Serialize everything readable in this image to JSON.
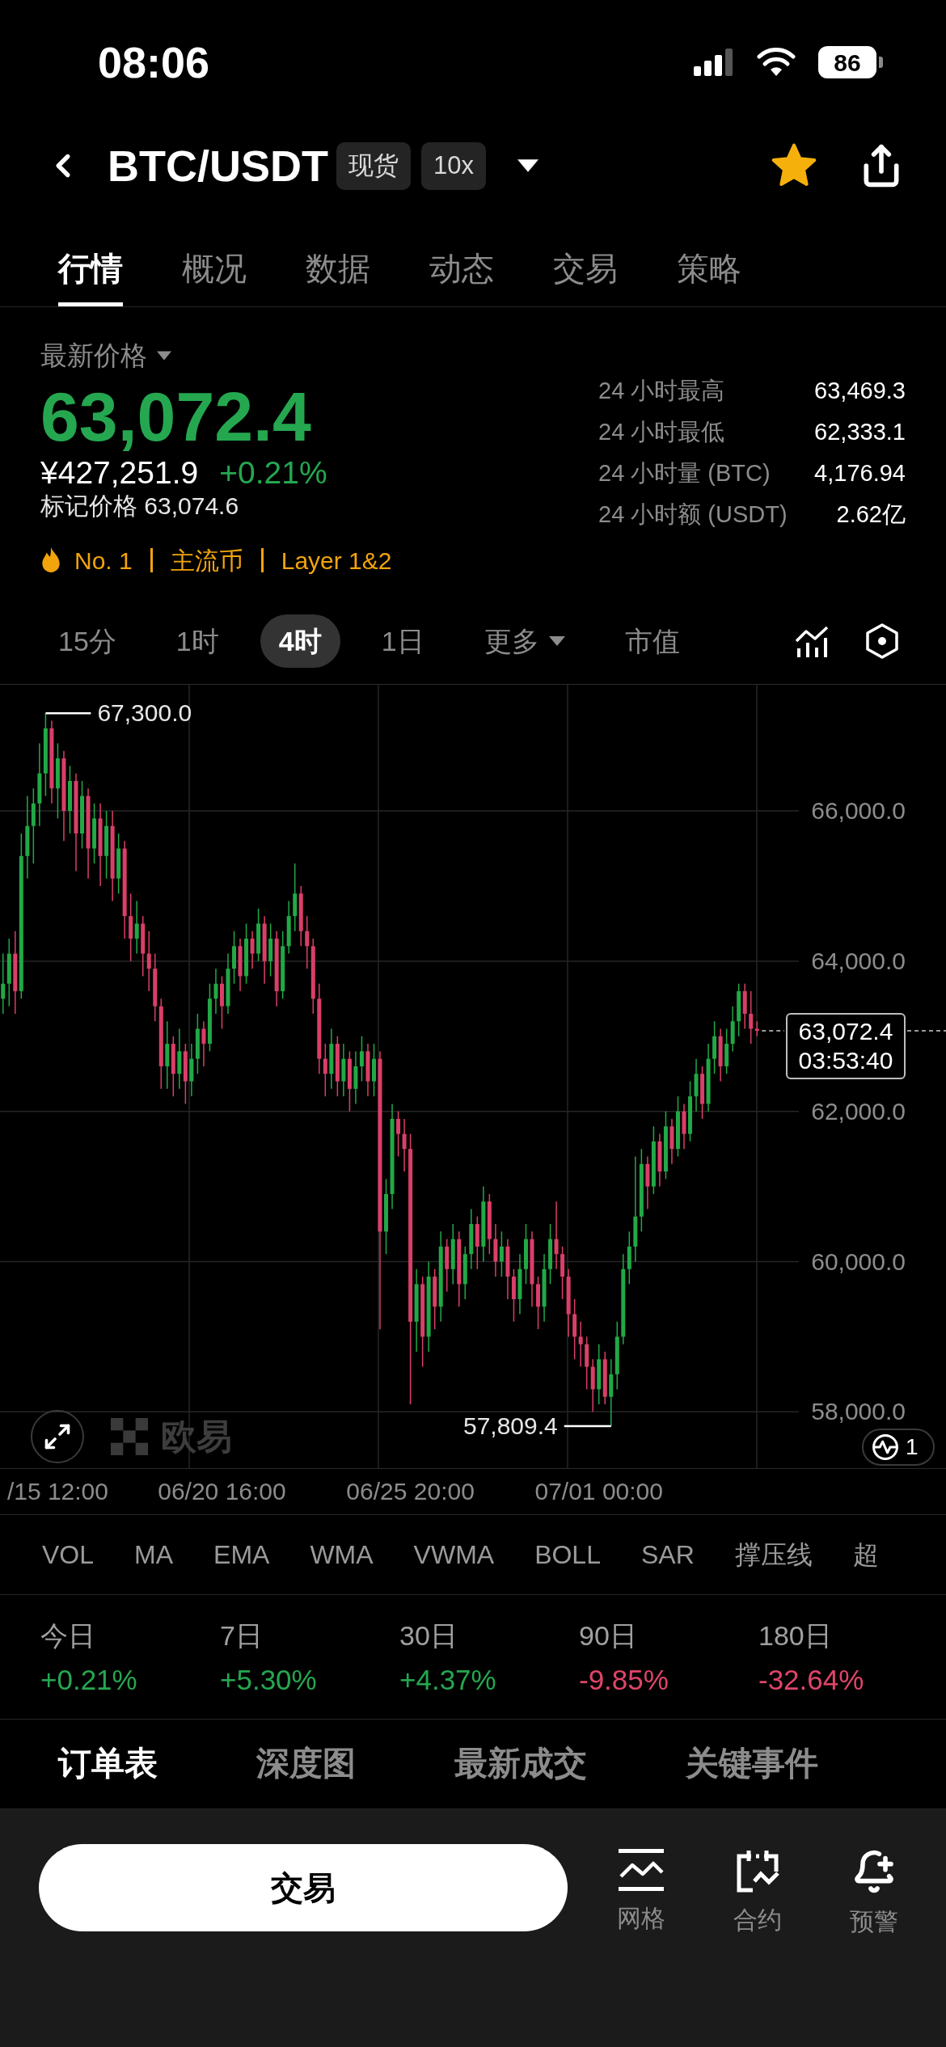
{
  "status_bar": {
    "time": "08:06",
    "battery": "86"
  },
  "header": {
    "title": "BTC/USDT",
    "badges": [
      "现货",
      "10x"
    ],
    "favorite": true
  },
  "tabs": [
    {
      "label": "行情",
      "selected": true
    },
    {
      "label": "概况",
      "selected": false
    },
    {
      "label": "数据",
      "selected": false
    },
    {
      "label": "动态",
      "selected": false
    },
    {
      "label": "交易",
      "selected": false
    },
    {
      "label": "策略",
      "selected": false
    }
  ],
  "price": {
    "type_label": "最新价格",
    "last": "63,072.4",
    "fiat": "¥427,251.9",
    "change": "+0.21%",
    "mark": "标记价格 63,074.6"
  },
  "tags": [
    {
      "label": "No. 1",
      "kind": "rank"
    },
    {
      "label": "主流币",
      "kind": "tag"
    },
    {
      "label": "Layer 1&2",
      "kind": "tag"
    }
  ],
  "stats": [
    {
      "label": "24 小时最高",
      "value": "63,469.3"
    },
    {
      "label": "24 小时最低",
      "value": "62,333.1"
    },
    {
      "label": "24 小时量 (BTC)",
      "value": "4,176.94"
    },
    {
      "label": "24 小时额 (USDT)",
      "value": "2.62亿"
    }
  ],
  "intervals": [
    {
      "label": "15分",
      "selected": false,
      "kind": "plain"
    },
    {
      "label": "1时",
      "selected": false,
      "kind": "plain"
    },
    {
      "label": "4时",
      "selected": true,
      "kind": "plain"
    },
    {
      "label": "1日",
      "selected": false,
      "kind": "plain"
    },
    {
      "label": "更多",
      "selected": false,
      "kind": "menu"
    },
    {
      "label": "市值",
      "selected": false,
      "kind": "plain"
    }
  ],
  "chart": {
    "high_label": "67,300.0",
    "low_label": "57,809.4",
    "last_price": "63,072.4",
    "countdown": "03:53:40",
    "watermark": "欧易",
    "overlay_count": "1",
    "chart_data": {
      "type": "candlestick",
      "grid": true,
      "categories": [
        null,
        null,
        null,
        null,
        null,
        null,
        null,
        null,
        null,
        "/15 12:00",
        null,
        null,
        null,
        null,
        null,
        null,
        null,
        null,
        null,
        null,
        null,
        null,
        null,
        null,
        null,
        null,
        null,
        null,
        null,
        null,
        null,
        null,
        null,
        null,
        null,
        null,
        "06/20 16:00",
        null,
        null,
        null,
        null,
        null,
        null,
        null,
        null,
        null,
        null,
        null,
        null,
        null,
        null,
        null,
        null,
        null,
        null,
        null,
        null,
        null,
        null,
        null,
        null,
        null,
        null,
        null,
        null,
        null,
        null,
        "06/25 20:00",
        null,
        null,
        null,
        null,
        null,
        null,
        null,
        null,
        null,
        null,
        null,
        null,
        null,
        null,
        null,
        null,
        null,
        null,
        null,
        null,
        null,
        null,
        null,
        null,
        null,
        null,
        null,
        null,
        null,
        null,
        "07/01 00:00",
        null,
        null,
        null,
        null,
        null,
        null,
        null,
        null,
        null,
        null,
        null,
        null,
        null,
        null,
        null,
        null,
        null,
        null,
        null,
        null,
        null,
        null,
        null,
        null,
        null,
        null
      ],
      "ohlc": [
        [
          63500,
          64100,
          63300,
          63700
        ],
        [
          63700,
          64300,
          63400,
          64100
        ],
        [
          64100,
          64400,
          63300,
          63600
        ],
        [
          63600,
          65700,
          63500,
          65400
        ],
        [
          65400,
          66200,
          65100,
          65800
        ],
        [
          65800,
          66300,
          65300,
          66100
        ],
        [
          66100,
          66900,
          65800,
          66500
        ],
        [
          66500,
          67300,
          66200,
          67100
        ],
        [
          67100,
          67200,
          66100,
          66300
        ],
        [
          66300,
          66900,
          65900,
          66700
        ],
        [
          66700,
          66800,
          65600,
          66000
        ],
        [
          66000,
          66600,
          65700,
          66400
        ],
        [
          66400,
          66500,
          65200,
          65700
        ],
        [
          65700,
          66400,
          65500,
          66200
        ],
        [
          66200,
          66300,
          65100,
          65500
        ],
        [
          65500,
          66100,
          65300,
          65900
        ],
        [
          65900,
          66100,
          65000,
          65400
        ],
        [
          65400,
          66000,
          65100,
          65800
        ],
        [
          65800,
          66000,
          64800,
          65100
        ],
        [
          65100,
          65700,
          64900,
          65500
        ],
        [
          65500,
          65600,
          64300,
          64600
        ],
        [
          64600,
          64900,
          64000,
          64300
        ],
        [
          64300,
          64800,
          64100,
          64500
        ],
        [
          64500,
          64600,
          63800,
          64100
        ],
        [
          64100,
          64400,
          63600,
          63900
        ],
        [
          63900,
          64100,
          63200,
          63400
        ],
        [
          63400,
          63500,
          62300,
          62600
        ],
        [
          62600,
          63200,
          62300,
          62900
        ],
        [
          62900,
          63000,
          62200,
          62500
        ],
        [
          62500,
          63100,
          62300,
          62800
        ],
        [
          62800,
          62900,
          62100,
          62400
        ],
        [
          62400,
          62900,
          62200,
          62700
        ],
        [
          62700,
          63300,
          62500,
          63100
        ],
        [
          63100,
          63200,
          62600,
          62900
        ],
        [
          62900,
          63700,
          62800,
          63500
        ],
        [
          63500,
          63900,
          63300,
          63700
        ],
        [
          63700,
          63800,
          63100,
          63400
        ],
        [
          63400,
          64100,
          63300,
          63900
        ],
        [
          63900,
          64400,
          63700,
          64200
        ],
        [
          64200,
          64300,
          63600,
          63800
        ],
        [
          63800,
          64500,
          63700,
          64300
        ],
        [
          64300,
          64400,
          63900,
          64100
        ],
        [
          64100,
          64700,
          64000,
          64500
        ],
        [
          64500,
          64600,
          63700,
          64000
        ],
        [
          64000,
          64500,
          63800,
          64300
        ],
        [
          64300,
          64400,
          63400,
          63600
        ],
        [
          63600,
          64400,
          63500,
          64200
        ],
        [
          64200,
          64800,
          64100,
          64600
        ],
        [
          64600,
          65300,
          64400,
          64900
        ],
        [
          64900,
          65000,
          64200,
          64400
        ],
        [
          64400,
          64600,
          63900,
          64200
        ],
        [
          64200,
          64300,
          63300,
          63500
        ],
        [
          63500,
          63700,
          62500,
          62700
        ],
        [
          62700,
          62900,
          62200,
          62500
        ],
        [
          62500,
          63100,
          62300,
          62900
        ],
        [
          62900,
          63000,
          62200,
          62400
        ],
        [
          62400,
          62900,
          62200,
          62700
        ],
        [
          62700,
          62800,
          62000,
          62300
        ],
        [
          62300,
          62800,
          62100,
          62600
        ],
        [
          62600,
          63000,
          62400,
          62800
        ],
        [
          62800,
          62900,
          62200,
          62400
        ],
        [
          62400,
          62900,
          62200,
          62700
        ],
        [
          62700,
          62800,
          59100,
          60400
        ],
        [
          60400,
          61100,
          60100,
          60900
        ],
        [
          60900,
          62100,
          60700,
          61900
        ],
        [
          61900,
          62000,
          61400,
          61700
        ],
        [
          61700,
          61900,
          61200,
          61500
        ],
        [
          61500,
          61700,
          58100,
          59200
        ],
        [
          59200,
          59900,
          58800,
          59700
        ],
        [
          59700,
          59800,
          58600,
          59000
        ],
        [
          59000,
          60000,
          58800,
          59800
        ],
        [
          59800,
          59900,
          59100,
          59400
        ],
        [
          59400,
          60400,
          59200,
          60200
        ],
        [
          60200,
          60300,
          59600,
          59900
        ],
        [
          59900,
          60500,
          59700,
          60300
        ],
        [
          60300,
          60400,
          59400,
          59700
        ],
        [
          59700,
          60200,
          59500,
          60100
        ],
        [
          60100,
          60700,
          59900,
          60500
        ],
        [
          60500,
          60600,
          59900,
          60200
        ],
        [
          60200,
          61000,
          60000,
          60800
        ],
        [
          60800,
          60900,
          60100,
          60300
        ],
        [
          60300,
          60500,
          59800,
          60000
        ],
        [
          60000,
          60400,
          59800,
          60200
        ],
        [
          60200,
          60300,
          59500,
          59800
        ],
        [
          59800,
          59900,
          59200,
          59500
        ],
        [
          59500,
          60100,
          59300,
          59900
        ],
        [
          59900,
          60500,
          59700,
          60300
        ],
        [
          60300,
          60400,
          59400,
          59700
        ],
        [
          59700,
          59800,
          59100,
          59400
        ],
        [
          59400,
          60100,
          59200,
          59900
        ],
        [
          59900,
          60500,
          59700,
          60300
        ],
        [
          60300,
          60800,
          59900,
          60100
        ],
        [
          60100,
          60200,
          59500,
          59800
        ],
        [
          59800,
          59900,
          59000,
          59300
        ],
        [
          59300,
          59500,
          58700,
          59000
        ],
        [
          59000,
          59200,
          58600,
          58900
        ],
        [
          58900,
          59000,
          58300,
          58600
        ],
        [
          58600,
          58700,
          58000,
          58300
        ],
        [
          58300,
          58900,
          58100,
          58700
        ],
        [
          58700,
          58800,
          58100,
          58200
        ],
        [
          58200,
          58700,
          57809.4,
          58500
        ],
        [
          58500,
          59200,
          58300,
          59000
        ],
        [
          59000,
          60100,
          58900,
          59900
        ],
        [
          59900,
          60400,
          59700,
          60200
        ],
        [
          60200,
          61400,
          60000,
          60600
        ],
        [
          60600,
          61500,
          60400,
          61300
        ],
        [
          61300,
          61400,
          60700,
          61000
        ],
        [
          61000,
          61800,
          60900,
          61600
        ],
        [
          61600,
          61700,
          61000,
          61200
        ],
        [
          61200,
          62000,
          61100,
          61800
        ],
        [
          61800,
          61900,
          61300,
          61500
        ],
        [
          61500,
          62200,
          61400,
          62000
        ],
        [
          62000,
          62100,
          61500,
          61700
        ],
        [
          61700,
          62400,
          61600,
          62200
        ],
        [
          62200,
          62700,
          62000,
          62500
        ],
        [
          62500,
          62600,
          61900,
          62100
        ],
        [
          62100,
          62900,
          62000,
          62700
        ],
        [
          62700,
          63200,
          62500,
          63000
        ],
        [
          63000,
          63100,
          62400,
          62600
        ],
        [
          62600,
          63100,
          62500,
          62900
        ],
        [
          62900,
          63400,
          62800,
          63200
        ],
        [
          63200,
          63700,
          63000,
          63600
        ],
        [
          63600,
          63700,
          63100,
          63300
        ],
        [
          63300,
          63600,
          62900,
          63100
        ],
        [
          63100,
          63200,
          63000,
          63072.4
        ]
      ],
      "ylim": [
        57250,
        67680
      ],
      "yticks": [
        {
          "value": 58000,
          "label": "58,000.0"
        },
        {
          "value": 60000,
          "label": "60,000.0"
        },
        {
          "value": 62000,
          "label": "62,000.0"
        },
        {
          "value": 64000,
          "label": "64,000.0"
        },
        {
          "value": 66000,
          "label": "66,000.0"
        }
      ]
    }
  },
  "indicators": [
    "VOL",
    "MA",
    "EMA",
    "WMA",
    "VWMA",
    "BOLL",
    "SAR",
    "撑压线",
    "超"
  ],
  "performance": [
    {
      "label": "今日",
      "value": "+0.21%",
      "rising": true
    },
    {
      "label": "7日",
      "value": "+5.30%",
      "rising": true
    },
    {
      "label": "30日",
      "value": "+4.37%",
      "rising": true
    },
    {
      "label": "90日",
      "value": "-9.85%",
      "rising": false
    },
    {
      "label": "180日",
      "value": "-32.64%",
      "rising": false
    }
  ],
  "order_tabs": [
    {
      "label": "订单表",
      "selected": true
    },
    {
      "label": "深度图",
      "selected": false
    },
    {
      "label": "最新成交",
      "selected": false
    },
    {
      "label": "关键事件",
      "selected": false
    }
  ],
  "action_bar": {
    "trade_button": "交易",
    "tools": [
      "网格",
      "合约",
      "预警"
    ]
  }
}
